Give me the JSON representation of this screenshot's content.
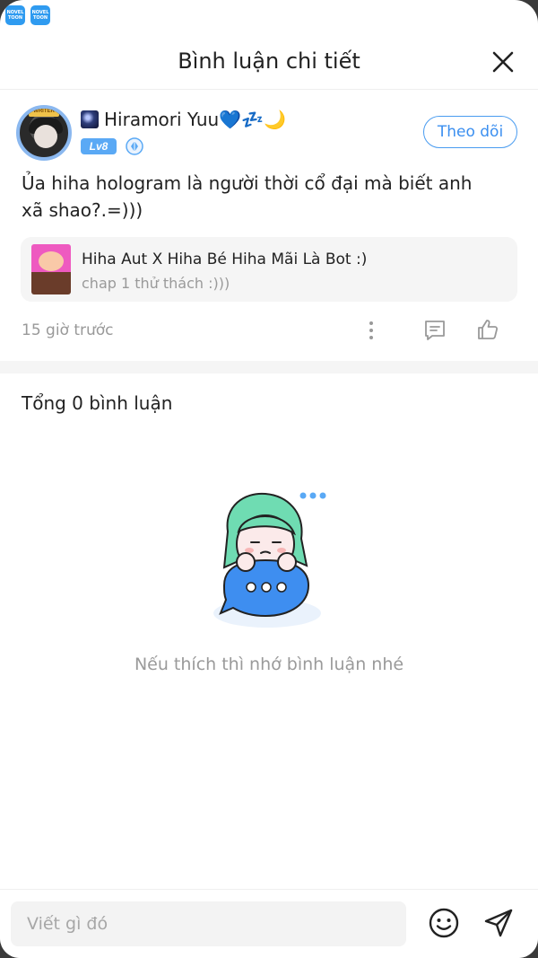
{
  "status_bar": {
    "apps": [
      {
        "name": "novel-toon-app",
        "line1": "NOVEL",
        "line2": "TOON"
      },
      {
        "name": "novel-toon-app",
        "line1": "NOVEL",
        "line2": "TOON"
      }
    ]
  },
  "header": {
    "title": "Bình luận chi tiết",
    "close_icon": "close-icon"
  },
  "comment": {
    "avatar_crown_text": "WRITER",
    "username": "Hiramori Yuu💙💤🌙",
    "level_badge": "Lv8",
    "follow_label": "Theo dõi",
    "text": "Ủa hiha hologram là người thời cổ đại mà biết anh xã shao?.=)))",
    "book": {
      "title": "Hiha Aut X Hiha Bé Hiha Mãi Là Bot :)",
      "chapter": "chap 1 thử thách :)))"
    },
    "timestamp": "15 giờ trước",
    "actions": {
      "more_icon": "more-vertical-icon",
      "reply_icon": "reply-icon",
      "like_icon": "thumbs-up-icon"
    }
  },
  "replies": {
    "total_label": "Tổng 0 bình luận",
    "empty_message": "Nếu thích thì nhớ bình luận nhé"
  },
  "input_bar": {
    "placeholder": "Viết gì đó",
    "emoji_icon": "emoji-icon",
    "send_icon": "send-icon"
  },
  "colors": {
    "accent": "#3b8ff0",
    "level_badge": "#5aa9f5",
    "muted_text": "#9a9a9a",
    "card_bg": "#f5f5f5"
  }
}
